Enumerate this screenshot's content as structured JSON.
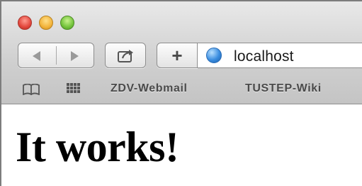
{
  "browser": {
    "address_bar": {
      "url": "localhost"
    },
    "toolbar": {
      "new_tab_label": "+"
    },
    "bookmarks": [
      {
        "label": "ZDV-Webmail"
      },
      {
        "label": "TUSTEP-Wiki"
      }
    ],
    "icons": {
      "close": "close-icon",
      "minimize": "minimize-icon",
      "zoom": "zoom-icon",
      "back": "back-arrow-icon",
      "forward": "forward-arrow-icon",
      "share": "share-icon",
      "globe": "globe-icon",
      "reading_list": "book-icon",
      "top_sites": "grid-icon"
    },
    "colors": {
      "close": "#e2463c",
      "minimize": "#f2b33a",
      "zoom": "#73c33b",
      "globe": "#3a8de0"
    }
  },
  "page": {
    "heading": "It works!"
  }
}
